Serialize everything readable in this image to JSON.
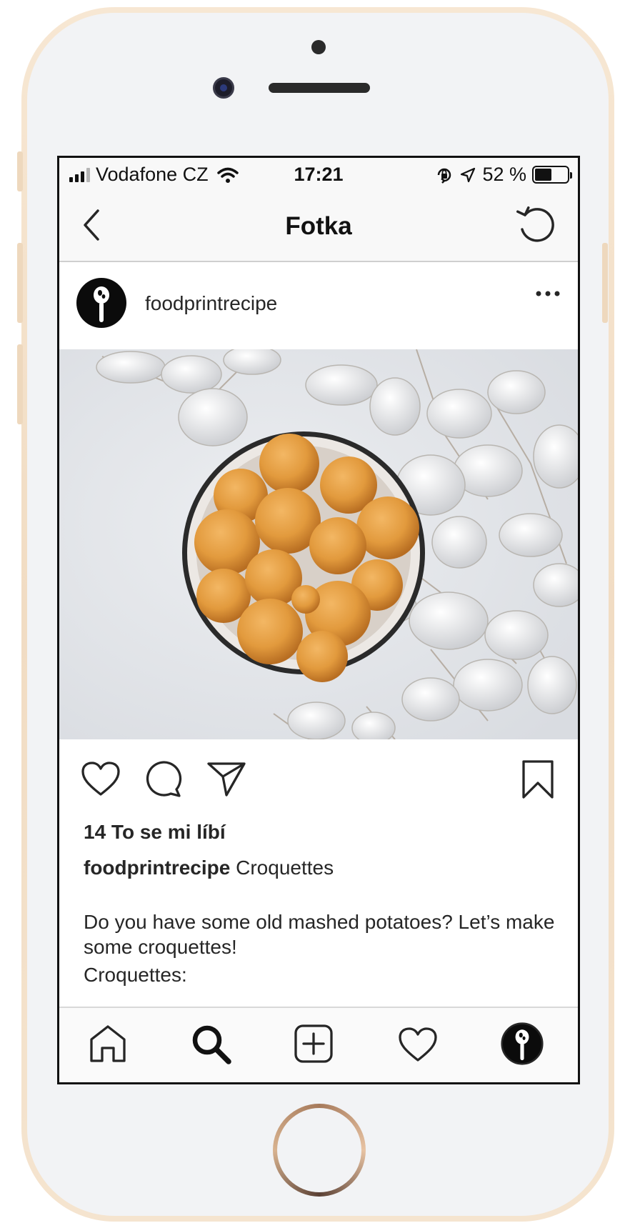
{
  "status_bar": {
    "carrier": "Vodafone CZ",
    "time": "17:21",
    "battery_text": "52 %",
    "battery_level": 0.52
  },
  "nav": {
    "title": "Fotka",
    "back_icon": "chevron-left-icon",
    "refresh_icon": "refresh-icon"
  },
  "post": {
    "username": "foodprintrecipe",
    "likes": "14 To se mi líbí",
    "caption_user": "foodprintrecipe",
    "caption_text": "Croquettes",
    "description": "Do you have some old mashed potatoes? Let’s make some croquettes!",
    "description_next": "Croquettes:"
  },
  "tab_bar": {
    "icons": [
      "home-icon",
      "search-icon",
      "new-post-icon",
      "activity-icon",
      "profile-icon"
    ]
  }
}
